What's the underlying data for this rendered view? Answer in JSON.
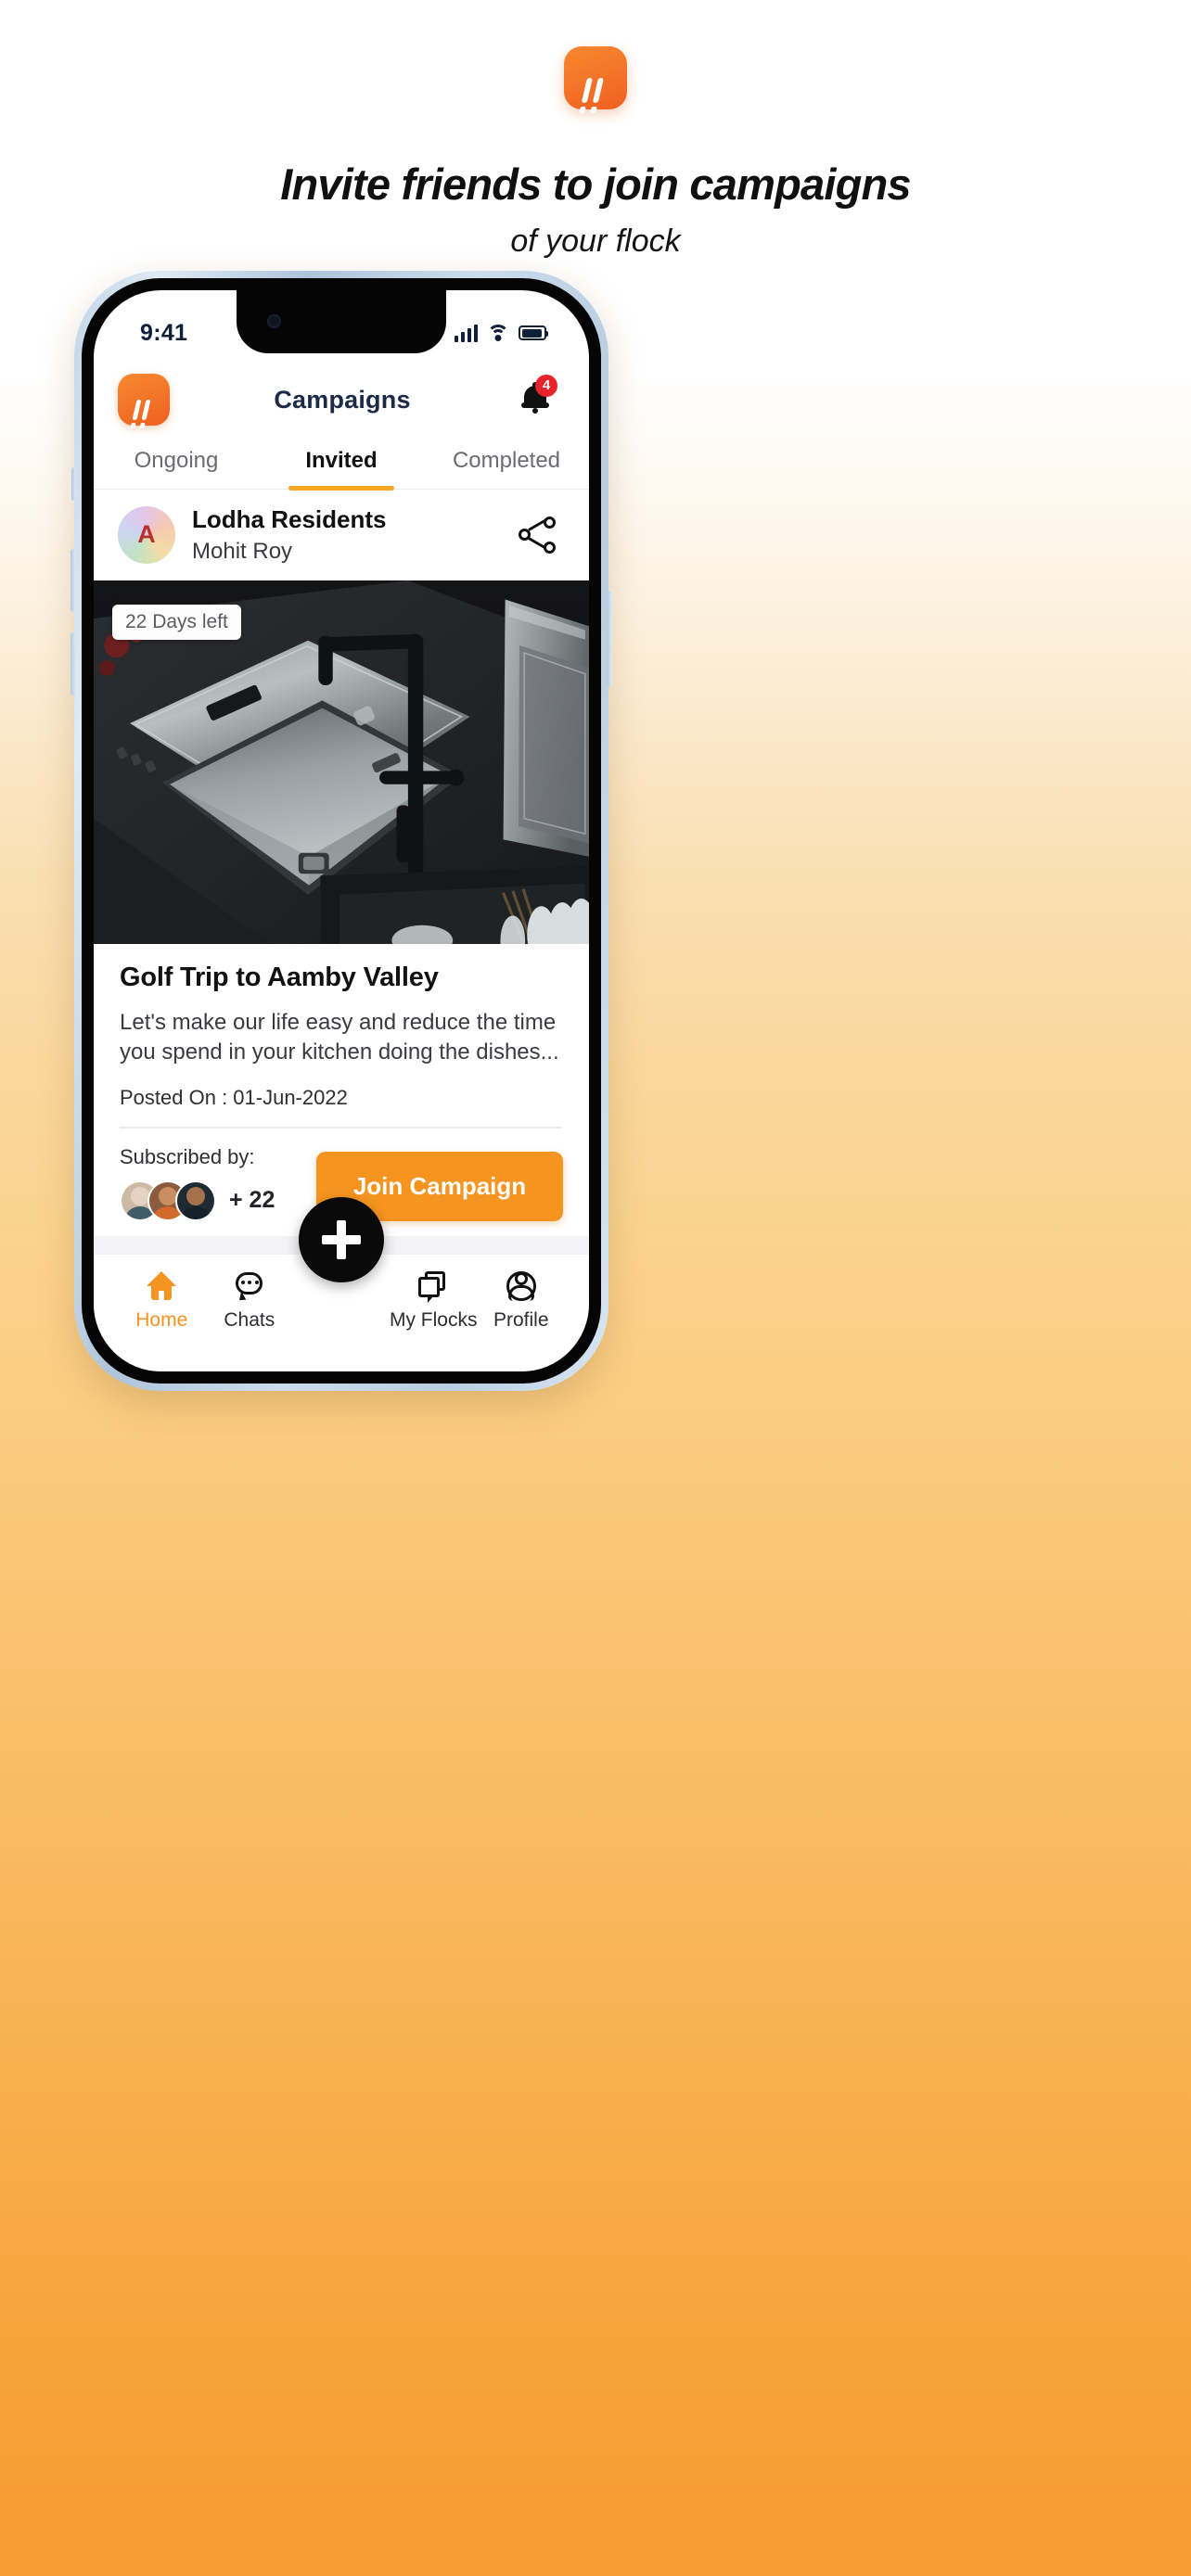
{
  "hero": {
    "logo_icon": "double-exclamation-logo",
    "headline": "Invite friends to join campaigns",
    "subheadline": "of your flock"
  },
  "phone": {
    "status_bar": {
      "time": "9:41",
      "signal_icon": "cellular-signal-icon",
      "wifi_icon": "wifi-icon",
      "battery_icon": "battery-full-icon"
    },
    "app_header": {
      "logo_icon": "app-logo-icon",
      "title": "Campaigns",
      "bell_icon": "notification-bell-icon",
      "bell_badge": "4"
    },
    "tabs": [
      {
        "label": "Ongoing",
        "active": false
      },
      {
        "label": "Invited",
        "active": true
      },
      {
        "label": "Completed",
        "active": false
      }
    ],
    "campaign": {
      "flock": {
        "avatar_initial": "A",
        "name": "Lodha Residents",
        "owner": "Mohit Roy",
        "share_icon": "share-icon"
      },
      "image_badge": "22 Days left",
      "image_alt": "kitchen-sink-photo",
      "title": "Golf Trip to Aamby Valley",
      "description": "Let's make our life easy and reduce the time you spend in your kitchen doing the dishes...",
      "posted_on": "Posted On : 01-Jun-2022",
      "subscribed_label": "Subscribed by:",
      "subscribed_more": "+ 22",
      "join_button": "Join Campaign"
    },
    "fab": {
      "icon": "plus-icon"
    },
    "bottom_nav": [
      {
        "label": "Home",
        "icon": "home-icon",
        "active": true
      },
      {
        "label": "Chats",
        "icon": "chat-bubble-icon",
        "active": false
      },
      {
        "label": "My Flocks",
        "icon": "flocks-icon",
        "active": false
      },
      {
        "label": "Profile",
        "icon": "person-icon",
        "active": false
      }
    ]
  },
  "colors": {
    "brand_orange": "#F59420",
    "logo_orange": "#EF5F1E",
    "badge_red": "#E8222A",
    "title_navy": "#1B2B47",
    "background_bottom": "#F69C31"
  }
}
